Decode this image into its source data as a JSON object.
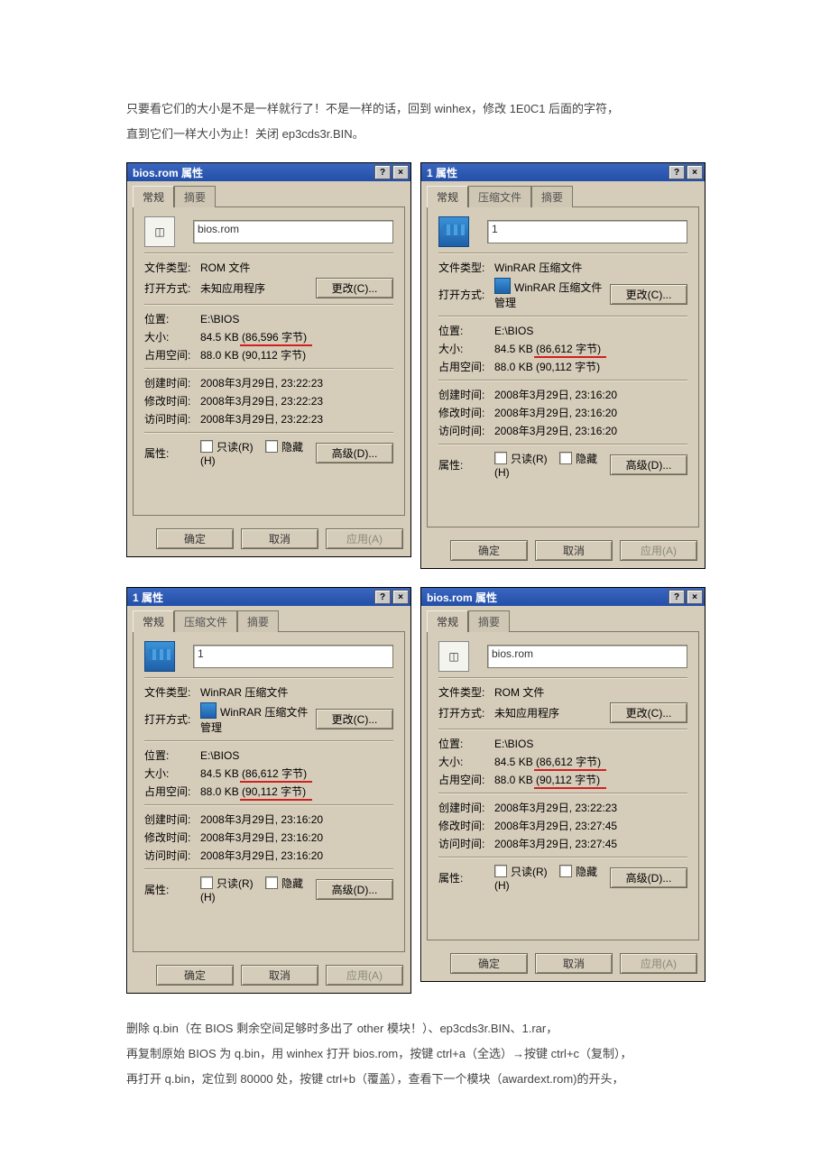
{
  "intro": {
    "p1": "只要看它们的大小是不是一样就行了！不是一样的话，回到 winhex，修改 1E0C1 后面的字符，",
    "p2": "直到它们一样大小为止！关闭 ep3cds3r.BIN。"
  },
  "labels": {
    "file_type": "文件类型:",
    "open_with": "打开方式:",
    "location": "位置:",
    "size": "大小:",
    "size_on_disk": "占用空间:",
    "created": "创建时间:",
    "modified": "修改时间:",
    "accessed": "访问时间:",
    "attributes": "属性:",
    "readonly": "只读(R)",
    "hidden": "隐藏(H)"
  },
  "buttons": {
    "change": "更改(C)...",
    "advanced": "高级(D)...",
    "ok": "确定",
    "cancel": "取消",
    "apply": "应用(A)"
  },
  "tabs": {
    "general": "常规",
    "archive": "压缩文件",
    "summary": "摘要"
  },
  "tbtn": {
    "help": "?",
    "close": "×"
  },
  "dlg_a": {
    "title": "bios.rom 属性",
    "filename": "bios.rom",
    "file_type": "ROM 文件",
    "open_with": "未知应用程序",
    "location": "E:\\BIOS",
    "size": "84.5 KB (86,596 字节)",
    "size_on_disk": "88.0 KB (90,112 字节)",
    "created": "2008年3月29日, 23:22:23",
    "modified": "2008年3月29日, 23:22:23",
    "accessed": "2008年3月29日, 23:22:23"
  },
  "dlg_b": {
    "title": "1 属性",
    "filename": "1",
    "file_type": "WinRAR 压缩文件",
    "open_with": "WinRAR 压缩文件管理",
    "location": "E:\\BIOS",
    "size": "84.5 KB (86,612 字节)",
    "size_on_disk": "88.0 KB (90,112 字节)",
    "created": "2008年3月29日, 23:16:20",
    "modified": "2008年3月29日, 23:16:20",
    "accessed": "2008年3月29日, 23:16:20"
  },
  "dlg_c": {
    "title": "1 属性",
    "filename": "1",
    "file_type": "WinRAR 压缩文件",
    "open_with": "WinRAR 压缩文件管理",
    "location": "E:\\BIOS",
    "size": "84.5 KB (86,612 字节)",
    "size_on_disk": "88.0 KB (90,112 字节)",
    "created": "2008年3月29日, 23:16:20",
    "modified": "2008年3月29日, 23:16:20",
    "accessed": "2008年3月29日, 23:16:20"
  },
  "dlg_d": {
    "title": "bios.rom 属性",
    "filename": "bios.rom",
    "file_type": "ROM 文件",
    "open_with": "未知应用程序",
    "location": "E:\\BIOS",
    "size": "84.5 KB (86,612 字节)",
    "size_on_disk": "88.0 KB (90,112 字节)",
    "created": "2008年3月29日, 23:22:23",
    "modified": "2008年3月29日, 23:27:45",
    "accessed": "2008年3月29日, 23:27:45"
  },
  "outro": {
    "p1": "删除 q.bin（在 BIOS 剩余空间足够时多出了 other 模块！）、ep3cds3r.BIN、1.rar，",
    "p2": "再复制原始 BIOS 为 q.bin，用 winhex 打开 bios.rom，按键 ctrl+a（全选）→按键 ctrl+c（复制），",
    "p3": "再打开 q.bin，定位到 80000 处，按键 ctrl+b（覆盖），查看下一个模块（awardext.rom)的开头，"
  }
}
